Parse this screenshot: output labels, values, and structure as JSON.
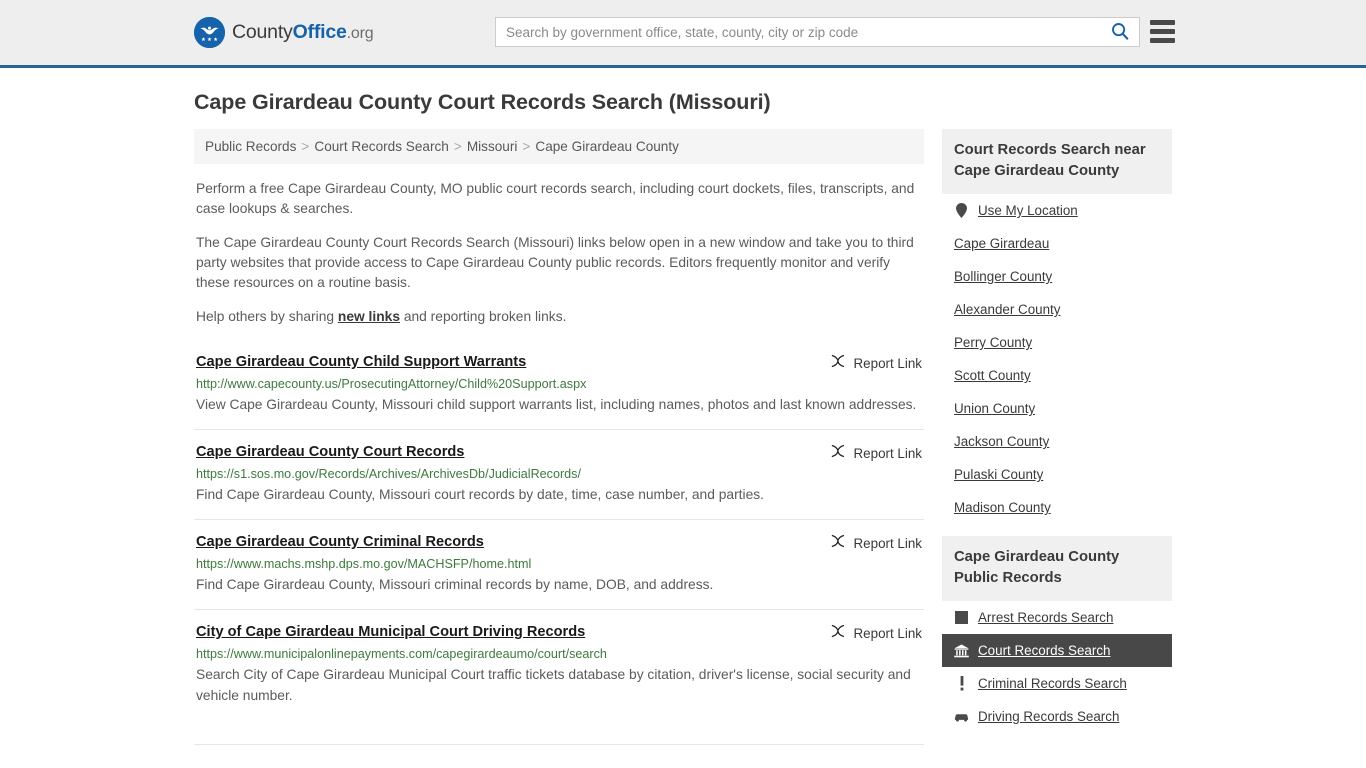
{
  "header": {
    "logo": {
      "icon": "eagle-seal-icon",
      "text_part1": "County",
      "text_part2": "Office",
      "text_part3": ".org"
    },
    "search": {
      "placeholder": "Search by government office, state, county, city or zip code",
      "value": "",
      "icon": "search-icon"
    },
    "menu_icon": "hamburger-menu-icon",
    "accent_color": "#2a6496",
    "background_color": "#eeeeee"
  },
  "page": {
    "title": "Cape Girardeau County Court Records Search (Missouri)"
  },
  "breadcrumb": {
    "separator": ">",
    "items": [
      {
        "label": "Public Records"
      },
      {
        "label": "Court Records Search"
      },
      {
        "label": "Missouri"
      },
      {
        "label": "Cape Girardeau County"
      }
    ]
  },
  "intro": {
    "paragraph1": "Perform a free Cape Girardeau County, MO public court records search, including court dockets, files, transcripts, and case lookups & searches.",
    "paragraph2": "The Cape Girardeau County Court Records Search (Missouri) links below open in a new window and take you to third party websites that provide access to Cape Girardeau County public records. Editors frequently monitor and verify these resources on a routine basis.",
    "paragraph3_before": "Help others by sharing ",
    "paragraph3_link": "new links",
    "paragraph3_after": " and reporting broken links."
  },
  "results": {
    "report_label": "Report Link",
    "report_icon": "broken-link-icon",
    "items": [
      {
        "title": "Cape Girardeau County Child Support Warrants",
        "url": "http://www.capecounty.us/ProsecutingAttorney/Child%20Support.aspx",
        "description": "View Cape Girardeau County, Missouri child support warrants list, including names, photos and last known addresses."
      },
      {
        "title": "Cape Girardeau County Court Records",
        "url": "https://s1.sos.mo.gov/Records/Archives/ArchivesDb/JudicialRecords/",
        "description": "Find Cape Girardeau County, Missouri court records by date, time, case number, and parties."
      },
      {
        "title": "Cape Girardeau County Criminal Records",
        "url": "https://www.machs.mshp.dps.mo.gov/MACHSFP/home.html",
        "description": "Find Cape Girardeau County, Missouri criminal records by name, DOB, and address."
      },
      {
        "title": "City of Cape Girardeau Municipal Court Driving Records",
        "url": "https://www.municipalonlinepayments.com/capegirardeaumo/court/search",
        "description": "Search City of Cape Girardeau Municipal Court traffic tickets database by citation, driver's license, social security and vehicle number."
      }
    ]
  },
  "sidebar": {
    "nearby": {
      "heading": "Court Records Search near Cape Girardeau County",
      "items": [
        {
          "label": "Use My Location",
          "icon": "map-pin-icon"
        },
        {
          "label": "Cape Girardeau",
          "icon": ""
        },
        {
          "label": "Bollinger County",
          "icon": ""
        },
        {
          "label": "Alexander County",
          "icon": ""
        },
        {
          "label": "Perry County",
          "icon": ""
        },
        {
          "label": "Scott County",
          "icon": ""
        },
        {
          "label": "Union County",
          "icon": ""
        },
        {
          "label": "Jackson County",
          "icon": ""
        },
        {
          "label": "Pulaski County",
          "icon": ""
        },
        {
          "label": "Madison County",
          "icon": ""
        }
      ]
    },
    "public_records": {
      "heading": "Cape Girardeau County Public Records",
      "active_color": "#484848",
      "items": [
        {
          "label": "Arrest Records Search",
          "icon": "fingerprint-card-icon",
          "active": false
        },
        {
          "label": "Court Records Search",
          "icon": "courthouse-icon",
          "active": true
        },
        {
          "label": "Criminal Records Search",
          "icon": "exclamation-icon",
          "active": false
        },
        {
          "label": "Driving Records Search",
          "icon": "car-icon",
          "active": false
        }
      ]
    }
  }
}
